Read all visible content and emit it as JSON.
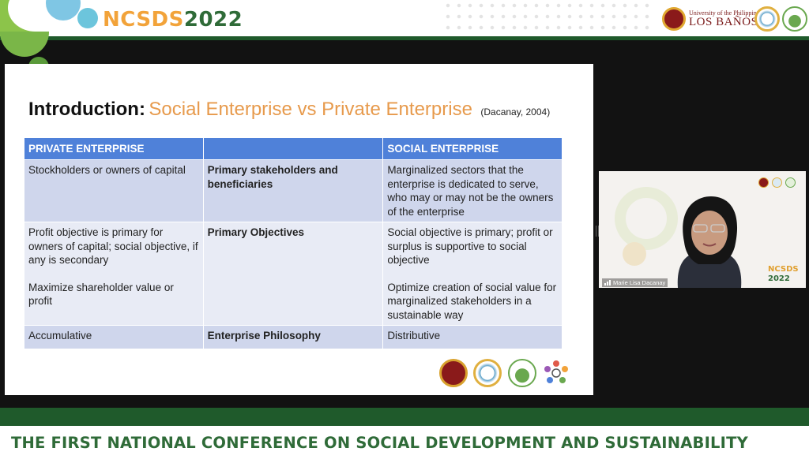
{
  "header": {
    "conference_short": "NCSDS",
    "conference_year": "2022",
    "university_line1": "University of the Philippines",
    "university_line2": "LOS BAÑOS"
  },
  "slide": {
    "heading_intro": "Introduction:",
    "heading_topic": "Social Enterprise vs Private Enterprise",
    "citation": "(Dacanay, 2004)",
    "table": {
      "headers": [
        "PRIVATE ENTERPRISE",
        "",
        "SOCIAL ENTERPRISE"
      ],
      "rows": [
        {
          "private": [
            "Stockholders or owners of capital"
          ],
          "aspect": "Primary stakeholders and beneficiaries",
          "social": [
            "Marginalized sectors  that the enterprise is dedicated to serve, who may or may not be the owners of the enterprise"
          ]
        },
        {
          "private": [
            "Profit objective is primary for owners of capital; social objective, if any is secondary",
            "Maximize shareholder value or profit"
          ],
          "aspect": "Primary Objectives",
          "social": [
            "Social objective is primary; profit or surplus is supportive to social objective",
            "Optimize creation of social value for marginalized stakeholders in a sustainable way"
          ]
        },
        {
          "private": [
            "Accumulative"
          ],
          "aspect": "Enterprise Philosophy",
          "social": [
            "Distributive"
          ]
        }
      ]
    }
  },
  "participant": {
    "name": "Marie Lisa Dacanay",
    "tile_brand": "NCSDS",
    "tile_year": "2022"
  },
  "footer": {
    "title": "THE FIRST NATIONAL CONFERENCE ON SOCIAL DEVELOPMENT AND SUSTAINABILITY"
  },
  "colors": {
    "accent_green": "#2f6b38",
    "accent_orange": "#f2a33a",
    "table_header": "#4f81d9"
  }
}
